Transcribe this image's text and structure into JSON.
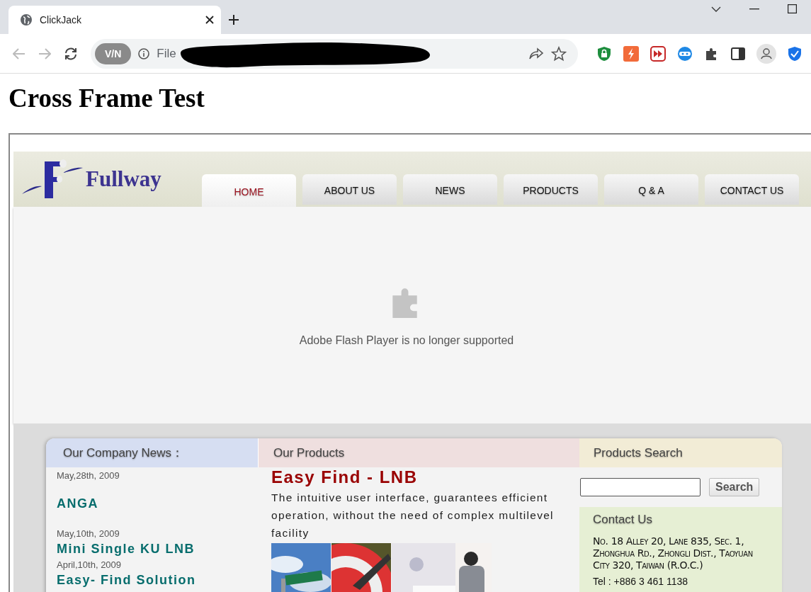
{
  "browser": {
    "tabs": [
      {
        "title": "ClickJack",
        "selected": true
      }
    ],
    "address": {
      "vpn_badge": "V/N",
      "scheme": "File"
    }
  },
  "page": {
    "heading": "Cross Frame Test"
  },
  "frame": {
    "logo": "Fullway",
    "nav": [
      {
        "label": "HOME",
        "selected": true
      },
      {
        "label": "ABOUT US",
        "selected": false
      },
      {
        "label": "NEWS",
        "selected": false
      },
      {
        "label": "PRODUCTS",
        "selected": false
      },
      {
        "label": "Q & A",
        "selected": false
      },
      {
        "label": "CONTACT US",
        "selected": false
      }
    ],
    "plugin_message": "Adobe Flash Player is no longer supported",
    "news": {
      "title": "Our Company News：",
      "items": [
        {
          "date": "May,28th, 2009",
          "headline": "ANGA"
        },
        {
          "date": "May,10th, 2009",
          "headline": "Mini Single KU LNB"
        },
        {
          "date": "April,10th, 2009",
          "headline": "Easy- Find Solution"
        }
      ]
    },
    "products": {
      "title": "Our Products",
      "headline": "Easy Find - LNB",
      "description": "The intuitive user interface, guarantees efficient operation, without the need of complex multilevel facility"
    },
    "search": {
      "title": "Products Search",
      "button": "Search"
    },
    "contact": {
      "title": "Contact Us",
      "address": "No. 18 Alley 20, Lane 835, Sec. 1, Zhonghua Rd., Zhongli Dist., Taoyuan City 320, Taiwan (R.O.C.)",
      "phone": "Tel : +886 3 461 1138"
    }
  }
}
